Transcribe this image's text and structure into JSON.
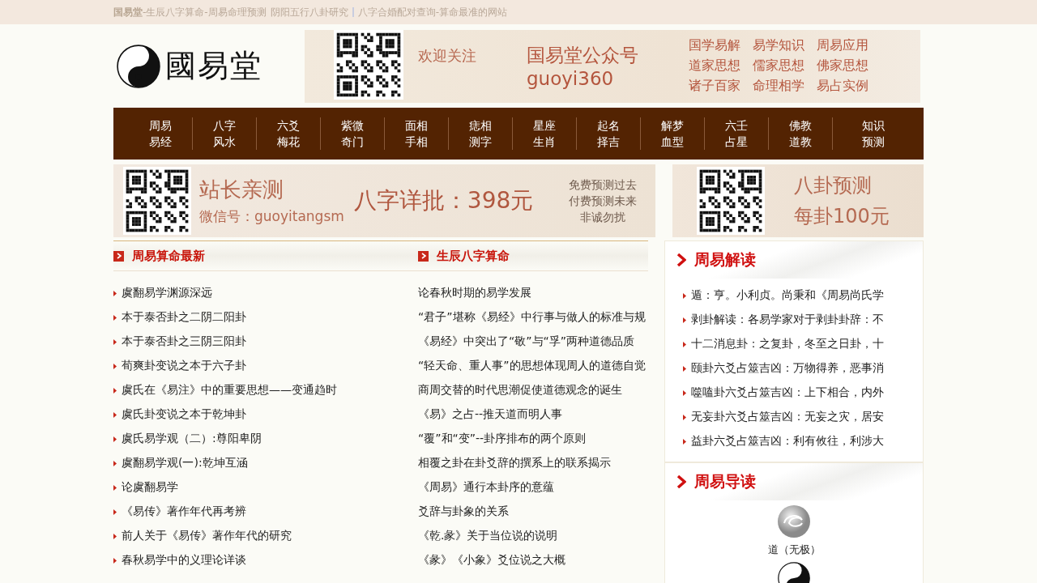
{
  "top_bar": {
    "brand": "国易堂",
    "segments": [
      "-生辰八字算命-周易命理预测",
      "阴阳五行八卦研究",
      "八字合婚配对查询-算命最准的网站"
    ]
  },
  "logo": {
    "text": "國易堂"
  },
  "banner": {
    "greeting": "欢迎关注",
    "account": "国易堂公众号",
    "wechat_id": "guoyi360",
    "links": [
      "国学易解",
      "易学知识",
      "周易应用",
      "道家思想",
      "儒家思想",
      "佛家思想",
      "诸子百家",
      "命理相学",
      "易占实例"
    ]
  },
  "nav": [
    {
      "line1": "周易",
      "line2": "易经"
    },
    {
      "line1": "八字",
      "line2": "风水"
    },
    {
      "line1": "六爻",
      "line2": "梅花"
    },
    {
      "line1": "紫微",
      "line2": "奇门"
    },
    {
      "line1": "面相",
      "line2": "手相"
    },
    {
      "line1": "痣相",
      "line2": "测字"
    },
    {
      "line1": "星座",
      "line2": "生肖"
    },
    {
      "line1": "起名",
      "line2": "择吉"
    },
    {
      "line1": "解梦",
      "line2": "血型"
    },
    {
      "line1": "六壬",
      "line2": "占星"
    },
    {
      "line1": "佛教",
      "line2": "道教"
    },
    {
      "line1": "知识",
      "line2": "预测"
    }
  ],
  "ad_left": {
    "title": "站长亲测",
    "wechat": "微信号：guoyitangsm",
    "offer": "八字详批：398元",
    "notes": [
      "免费预测过去",
      "付费预测未来",
      "非诚勿扰"
    ]
  },
  "ad_right": {
    "lines": [
      "八卦预测",
      "每卦100元"
    ]
  },
  "latest": {
    "title": "周易算命最新",
    "items": [
      "虞翻易学渊源深远",
      "本于泰否卦之二阴二阳卦",
      "本于泰否卦之三阴三阳卦",
      "荀爽卦变说之本于六子卦",
      "虞氏在《易注》中的重要思想——变通趋时",
      "虞氏卦变说之本于乾坤卦",
      "虞氏易学观（二）:尊阳卑阴",
      "虞翻易学观(一):乾坤互涵",
      "论虞翻易学",
      "《易传》著作年代再考辨",
      "前人关于《易传》著作年代的研究",
      "春秋易学中的义理论详谈"
    ]
  },
  "bazi": {
    "title": "生辰八字算命",
    "items": [
      "论春秋时期的易学发展",
      "“君子”堪称《易经》中行事与做人的标准与规",
      "《易经》中突出了“敬”与“孚”两种道德品质",
      "“轻天命、重人事”的思想体现周人的道德自觉",
      "商周交替的时代思潮促使道德观念的诞生",
      "《易》之占--推天道而明人事",
      "“覆”和“变”--卦序排布的两个原则",
      "相覆之卦在卦爻辞的撰系上的联系揭示",
      "《周易》通行本卦序的意蕴",
      "爻辞与卦象的关系",
      "《乾.彖》关于当位说的说明",
      "《彖》《小象》爻位说之大概"
    ]
  },
  "jiedu": {
    "title": "周易解读",
    "items": [
      "遁：亨。小利贞。尚秉和《周易尚氏学",
      "剥卦解读：各易学家对于剥卦卦辞：不",
      "十二消息卦：之复卦，冬至之日卦，十",
      "颐卦六爻占筮吉凶：万物得养，恶事消",
      "噬嗑卦六爻占筮吉凶：上下相合，内外",
      "无妄卦六爻占筮吉凶：无妄之灾，居安",
      "益卦六爻占筮吉凶：利有攸往，利涉大"
    ]
  },
  "daodu": {
    "title": "周易导读",
    "items": [
      {
        "kind": "wuji",
        "label": "道（无极）"
      },
      {
        "kind": "taiji"
      }
    ]
  }
}
